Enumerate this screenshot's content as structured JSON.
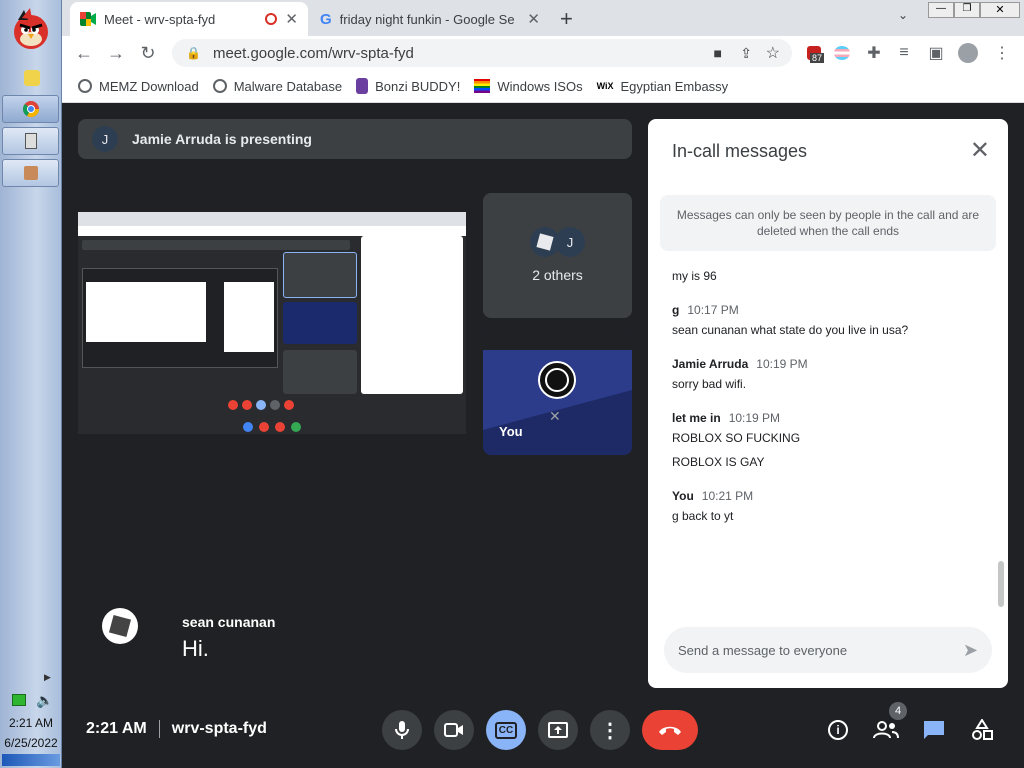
{
  "taskbar": {
    "time": "2:21 AM",
    "date": "6/25/2022"
  },
  "browser": {
    "tabs": [
      {
        "title": "Meet - wrv-spta-fyd",
        "icon": "meet-icon",
        "recording": true,
        "active": true
      },
      {
        "title": "friday night funkin - Google Se",
        "icon": "google-icon",
        "active": false
      }
    ],
    "new_tab_label": "+",
    "url": "meet.google.com/wrv-spta-fyd",
    "extension_badge": "87",
    "bookmarks": [
      {
        "label": "MEMZ Download",
        "icon": "globe-icon"
      },
      {
        "label": "Malware Database",
        "icon": "globe-icon"
      },
      {
        "label": "Bonzi BUDDY!",
        "icon": "bonzi-icon"
      },
      {
        "label": "Windows ISOs",
        "icon": "rainbow-flag-icon"
      },
      {
        "label": "Egyptian Embassy",
        "icon": "wix-icon"
      }
    ],
    "wix_text": "WiX"
  },
  "meet": {
    "presenter_initial": "J",
    "presenting_banner": "Jamie Arruda is presenting",
    "others_label": "2 others",
    "others_initial": "J",
    "you_label": "You",
    "caption_speaker": "sean cunanan",
    "caption_text": "Hi.",
    "meeting_time": "2:21 AM",
    "meeting_code": "wrv-spta-fyd",
    "participants_count": "4",
    "cc_label": "CC"
  },
  "chat": {
    "title": "In-call messages",
    "notice": "Messages can only be seen by people in the call and are deleted when the call ends",
    "messages": [
      {
        "sender": "",
        "time": "",
        "lines": [
          "my is 96"
        ]
      },
      {
        "sender": "g",
        "time": "10:17 PM",
        "lines": [
          "sean cunanan what state do you live in usa?"
        ]
      },
      {
        "sender": "Jamie Arruda",
        "time": "10:19 PM",
        "lines": [
          "sorry bad wifi."
        ]
      },
      {
        "sender": "let me in",
        "time": "10:19 PM",
        "lines": [
          "ROBLOX SO FUCKING",
          "ROBLOX IS GAY"
        ]
      },
      {
        "sender": "You",
        "time": "10:21 PM",
        "lines": [
          "g back to yt"
        ]
      }
    ],
    "composer_placeholder": "Send a message to everyone"
  },
  "colors": {
    "meet_bg": "#202124",
    "tile_bg": "#3c4043",
    "accent_blue": "#8ab4f8",
    "end_call_red": "#ea4335",
    "chat_icon_blue": "#1a73e8"
  }
}
